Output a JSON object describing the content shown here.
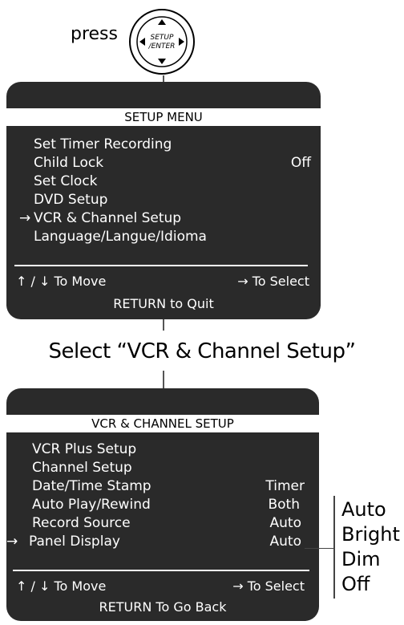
{
  "top": {
    "press_label": "press",
    "button_line1": "SETUP",
    "button_line2": "/ENTER"
  },
  "setup_menu": {
    "title": "SETUP MENU",
    "items": [
      {
        "label": "Set Timer Recording",
        "value": "",
        "selected": false
      },
      {
        "label": "Child Lock",
        "value": "Off",
        "selected": false
      },
      {
        "label": "Set Clock",
        "value": "",
        "selected": false
      },
      {
        "label": "DVD Setup",
        "value": "",
        "selected": false
      },
      {
        "label": "VCR & Channel Setup",
        "value": "",
        "selected": true
      },
      {
        "label": "Language/Langue/Idioma",
        "value": "",
        "selected": false
      }
    ],
    "move_hint": "To Move",
    "select_hint": "To Select",
    "quit_hint": "RETURN to Quit"
  },
  "caption": "Select “VCR & Channel Setup”",
  "vcr_menu": {
    "title": "VCR & CHANNEL SETUP",
    "items": [
      {
        "label": "VCR Plus Setup",
        "value": "",
        "selected": false
      },
      {
        "label": "Channel Setup",
        "value": "",
        "selected": false
      },
      {
        "label": "Date/Time Stamp",
        "value": "Timer",
        "selected": false
      },
      {
        "label": "Auto Play/Rewind",
        "value": "Both",
        "selected": false
      },
      {
        "label": "Record Source",
        "value": "Auto",
        "selected": false
      },
      {
        "label": "Panel Display",
        "value": "Auto",
        "selected": true
      }
    ],
    "move_hint": "To Move",
    "select_hint": "To Select",
    "back_hint": "RETURN To Go Back"
  },
  "panel_display_options": [
    "Auto",
    "Bright",
    "Dim",
    "Off"
  ],
  "icons": {
    "up": "up-arrow-icon",
    "down": "down-arrow-icon",
    "right": "right-arrow-icon"
  }
}
